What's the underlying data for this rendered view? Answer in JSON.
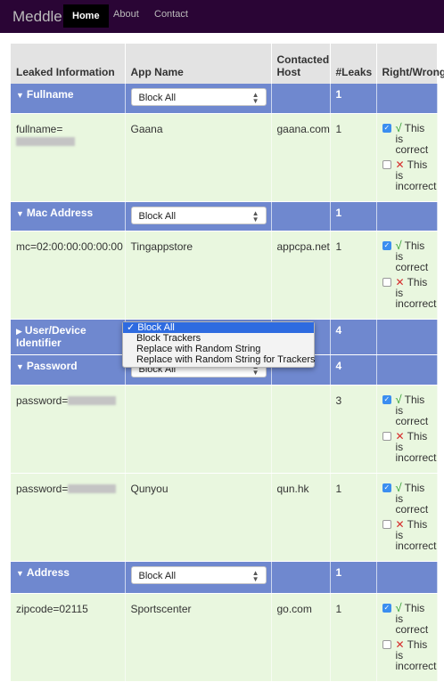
{
  "nav": {
    "brand": "Meddle",
    "home": "Home",
    "about": "About",
    "contact": "Contact"
  },
  "table": {
    "headers": {
      "info": "Leaked Information",
      "app": "App Name",
      "host": "Contacted Host",
      "leaks": "#Leaks",
      "rw": "Right/Wrong"
    }
  },
  "select_default": "Block All",
  "groups": [
    {
      "label": "Fullname",
      "count": "1"
    },
    {
      "label": "Mac Address",
      "count": "1"
    },
    {
      "label": "User/Device Identifier",
      "count": "4"
    },
    {
      "label": "Password",
      "count": "4"
    },
    {
      "label": "Address",
      "count": "1"
    }
  ],
  "rows": [
    {
      "info": "fullname=",
      "app": "Gaana",
      "host": "gaana.com",
      "leaks": "1"
    },
    {
      "info": "mc=02:00:00:00:00:00",
      "app": "Tingappstore",
      "host": "appcpa.net",
      "leaks": "1"
    },
    {
      "info": "password=",
      "app": "",
      "host": "",
      "leaks": "3"
    },
    {
      "info": "password=",
      "app": "Qunyou",
      "host": "qun.hk",
      "leaks": "1"
    },
    {
      "info": "zipcode=02115",
      "app": "Sportscenter",
      "host": "go.com",
      "leaks": "1"
    }
  ],
  "rw": {
    "correct": "This is correct",
    "incorrect": "This is incorrect"
  },
  "dropdown": {
    "options": [
      "Block All",
      "Block Trackers",
      "Replace with Random String",
      "Replace with Random String for Trackers"
    ],
    "selected": "Block All"
  }
}
